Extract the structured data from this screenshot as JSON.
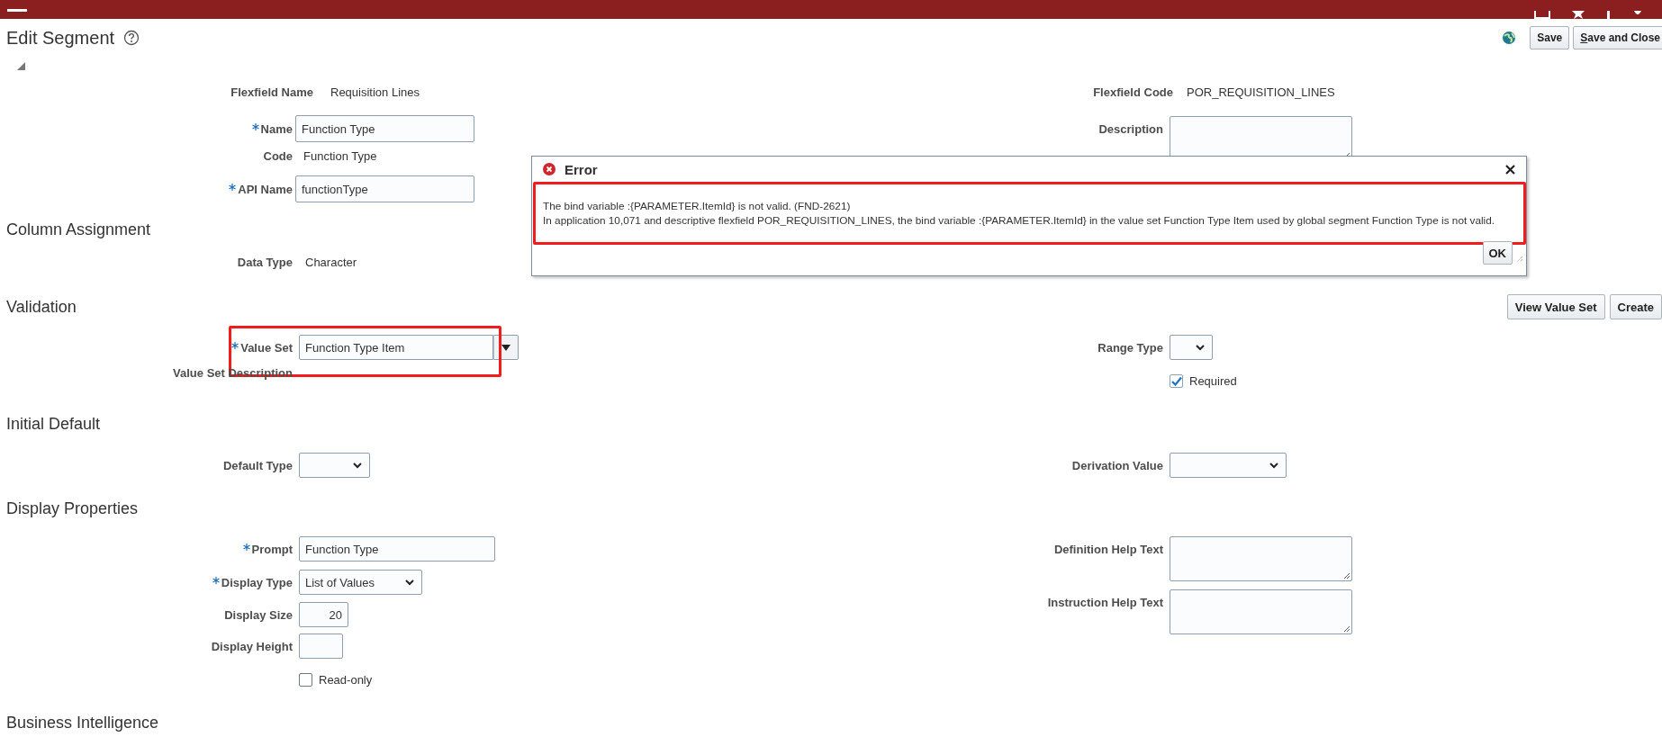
{
  "page": {
    "title": "Edit Segment",
    "buttons": [
      {
        "label": "Save",
        "mnemonic": false
      },
      {
        "label": "Save and Close",
        "mnemonic": true
      }
    ]
  },
  "sections": [
    {
      "left": [
        {
          "kind": "text",
          "label": "Flexfield Name",
          "required": false,
          "highlighted": false,
          "value": "Requisition Lines"
        },
        {
          "kind": "input",
          "label": "Name",
          "required": true,
          "highlighted": false,
          "value": "Function Type"
        },
        {
          "kind": "text",
          "label": "Code",
          "required": false,
          "highlighted": false,
          "value": "Function Type"
        },
        {
          "kind": "input",
          "label": "API Name",
          "required": true,
          "highlighted": false,
          "value": "functionType"
        }
      ],
      "right": [
        {
          "kind": "text",
          "label": "Flexfield Code",
          "required": false,
          "highlighted": false,
          "value": "POR_REQUISITION_LINES"
        },
        {
          "kind": "textarea",
          "label": "Description",
          "required": false,
          "highlighted": false
        }
      ]
    },
    {
      "title": "Column Assignment",
      "left": [
        {
          "kind": "text",
          "label": "Data Type",
          "required": false,
          "highlighted": false,
          "value": "Character"
        }
      ]
    },
    {
      "title": "Validation",
      "buttons": [
        {
          "label": "View Value Set"
        },
        {
          "label": "Create"
        }
      ],
      "left": [
        {
          "kind": "lov",
          "label": "Value Set",
          "required": true,
          "highlighted": true,
          "value": "Function Type Item"
        },
        {
          "kind": "label",
          "label": "Value Set Description",
          "required": false,
          "highlighted": false
        }
      ],
      "right": [
        {
          "kind": "select",
          "label": "Range Type",
          "required": false,
          "highlighted": false
        },
        {
          "kind": "checkbox",
          "label": "Required",
          "checked": true,
          "highlighted": false
        }
      ]
    },
    {
      "title": "Initial Default",
      "left": [
        {
          "kind": "select",
          "label": "Default Type",
          "required": false,
          "highlighted": false
        }
      ],
      "right": [
        {
          "kind": "select",
          "label": "Derivation Value",
          "required": false,
          "highlighted": false
        }
      ]
    },
    {
      "title": "Display Properties",
      "left": [
        {
          "kind": "input",
          "label": "Prompt",
          "required": true,
          "highlighted": false,
          "value": "Function Type"
        },
        {
          "kind": "select",
          "label": "Display Type",
          "required": true,
          "highlighted": false,
          "value": "List of Values"
        },
        {
          "kind": "input",
          "label": "Display Size",
          "required": false,
          "highlighted": false,
          "value": "20"
        },
        {
          "kind": "input",
          "label": "Display Height",
          "required": false,
          "highlighted": false
        },
        {
          "kind": "checkbox",
          "label": "Read-only",
          "checked": false,
          "highlighted": false
        }
      ],
      "right": [
        {
          "kind": "textarea",
          "label": "Definition Help Text",
          "required": false,
          "highlighted": false
        },
        {
          "kind": "textarea",
          "label": "Instruction Help Text",
          "required": false,
          "highlighted": false
        }
      ]
    },
    {
      "title": "Business Intelligence"
    }
  ],
  "dialog": {
    "kind": "error",
    "title": "Error",
    "highlighted": true,
    "message": [
      "The bind variable :{PARAMETER.ItemId} is not valid. (FND-2621)",
      "In application 10,071 and descriptive flexfield POR_REQUISITION_LINES, the bind variable :{PARAMETER.ItemId} in the value set Function Type Item used by global segment Function Type is not valid."
    ],
    "buttons": [
      {
        "label": "OK"
      }
    ]
  }
}
